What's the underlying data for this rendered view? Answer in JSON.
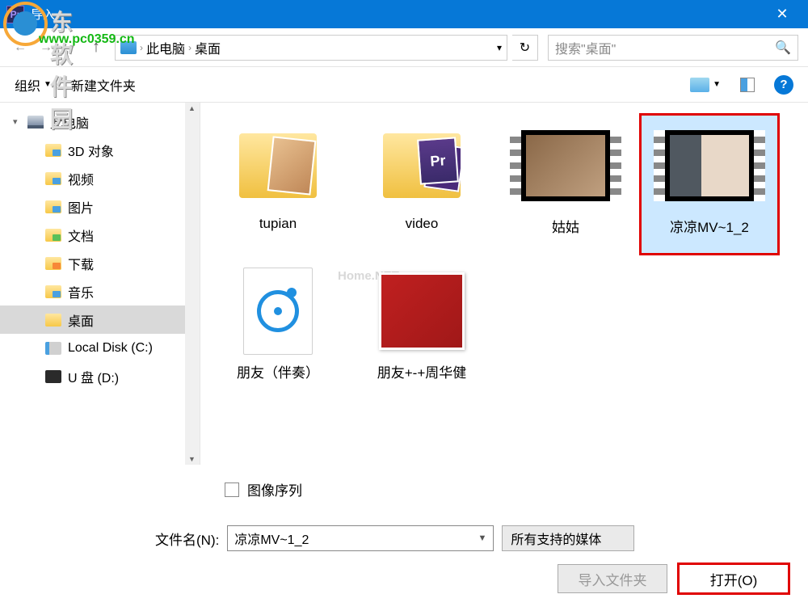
{
  "watermark": {
    "site_name": "东软件园",
    "url": "www.pc0359.cn",
    "center": "Home.NET"
  },
  "titlebar": {
    "title": "导入",
    "app_icon_text": "Pr"
  },
  "breadcrumb": {
    "loc1": "此电脑",
    "loc2": "桌面"
  },
  "search": {
    "placeholder": "搜索\"桌面\""
  },
  "toolbar": {
    "organize": "组织",
    "new_folder": "新建文件夹"
  },
  "sidebar": {
    "items": [
      {
        "label": "此电脑",
        "icon": "pc",
        "depth": 0,
        "expanded": true
      },
      {
        "label": "3D 对象",
        "icon": "folder-blue",
        "depth": 1
      },
      {
        "label": "视频",
        "icon": "folder-blue",
        "depth": 1
      },
      {
        "label": "图片",
        "icon": "folder-blue",
        "depth": 1
      },
      {
        "label": "文档",
        "icon": "folder-green",
        "depth": 1
      },
      {
        "label": "下载",
        "icon": "folder-orange",
        "depth": 1
      },
      {
        "label": "音乐",
        "icon": "folder-blue",
        "depth": 1
      },
      {
        "label": "桌面",
        "icon": "folder-plain",
        "depth": 1,
        "selected": true
      },
      {
        "label": "Local Disk (C:)",
        "icon": "disk",
        "depth": 1
      },
      {
        "label": "U 盘 (D:)",
        "icon": "usb",
        "depth": 1
      }
    ]
  },
  "files": {
    "items": [
      {
        "label": "tupian",
        "type": "folder-photo"
      },
      {
        "label": "video",
        "type": "folder-video"
      },
      {
        "label": "姑姑",
        "type": "video",
        "frame": "gugu"
      },
      {
        "label": "凉凉MV~1_2",
        "type": "video",
        "frame": "mv",
        "selected": true,
        "highlighted": true
      },
      {
        "label": "朋友（伴奏）",
        "type": "audio"
      },
      {
        "label": "朋友+-+周华健",
        "type": "image"
      }
    ]
  },
  "options": {
    "image_sequence": "图像序列"
  },
  "bottom": {
    "filename_label": "文件名(N):",
    "filename_value": "凉凉MV~1_2",
    "filetype": "所有支持的媒体",
    "import_folder": "导入文件夹",
    "open": "打开(O)"
  }
}
